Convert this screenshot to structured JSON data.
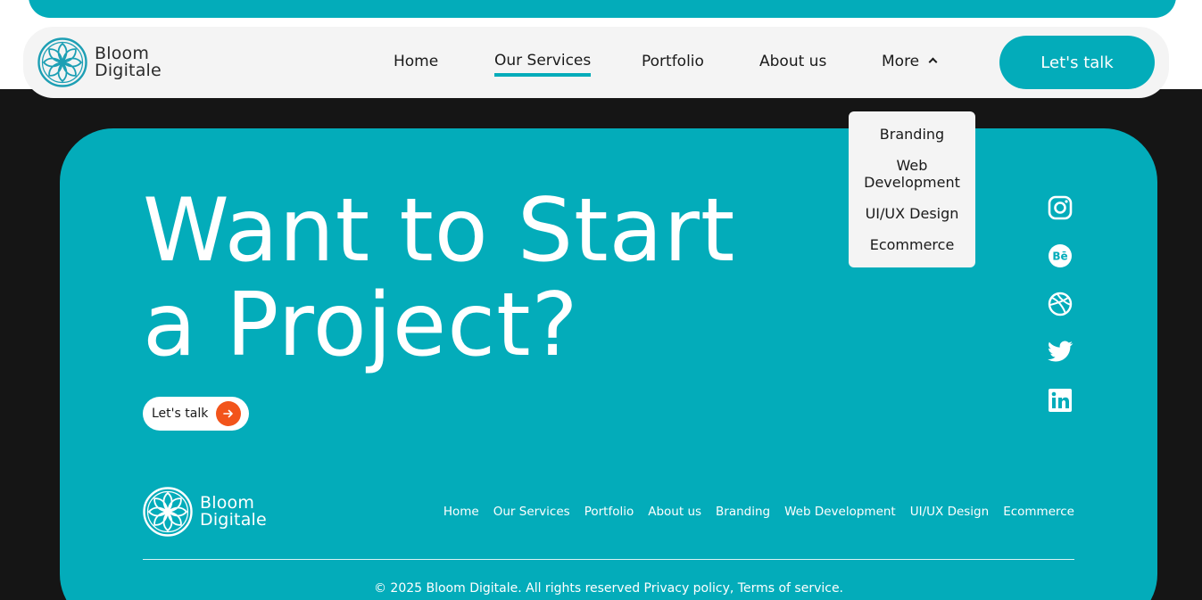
{
  "brand": {
    "line1": "Bloom",
    "line2": "Digitale",
    "accent": "#03acba",
    "orange": "#f2541b"
  },
  "nav": {
    "items": [
      "Home",
      "Our Services",
      "Portfolio",
      "About us",
      "More"
    ],
    "active": "Our Services",
    "cta": "Let's talk"
  },
  "dropdown": {
    "items": [
      "Branding",
      "Web\nDevelopment",
      "UI/UX Design",
      "Ecommerce"
    ]
  },
  "hero": {
    "headline_line1": "Want to Start",
    "headline_line2": "a Project?",
    "button": "Let's talk",
    "button_icon": "arrow-right-icon"
  },
  "social": [
    "instagram-icon",
    "behance-icon",
    "dribbble-icon",
    "twitter-icon",
    "linkedin-icon"
  ],
  "footer": {
    "links": [
      "Home",
      "Our Services",
      "Portfolio",
      "About us",
      "Branding",
      "Web Development",
      "UI/UX Design",
      "Ecommerce"
    ],
    "copyright": "© 2025 Bloom Digitale.  All rights reserved Privacy policy, Terms of service."
  }
}
